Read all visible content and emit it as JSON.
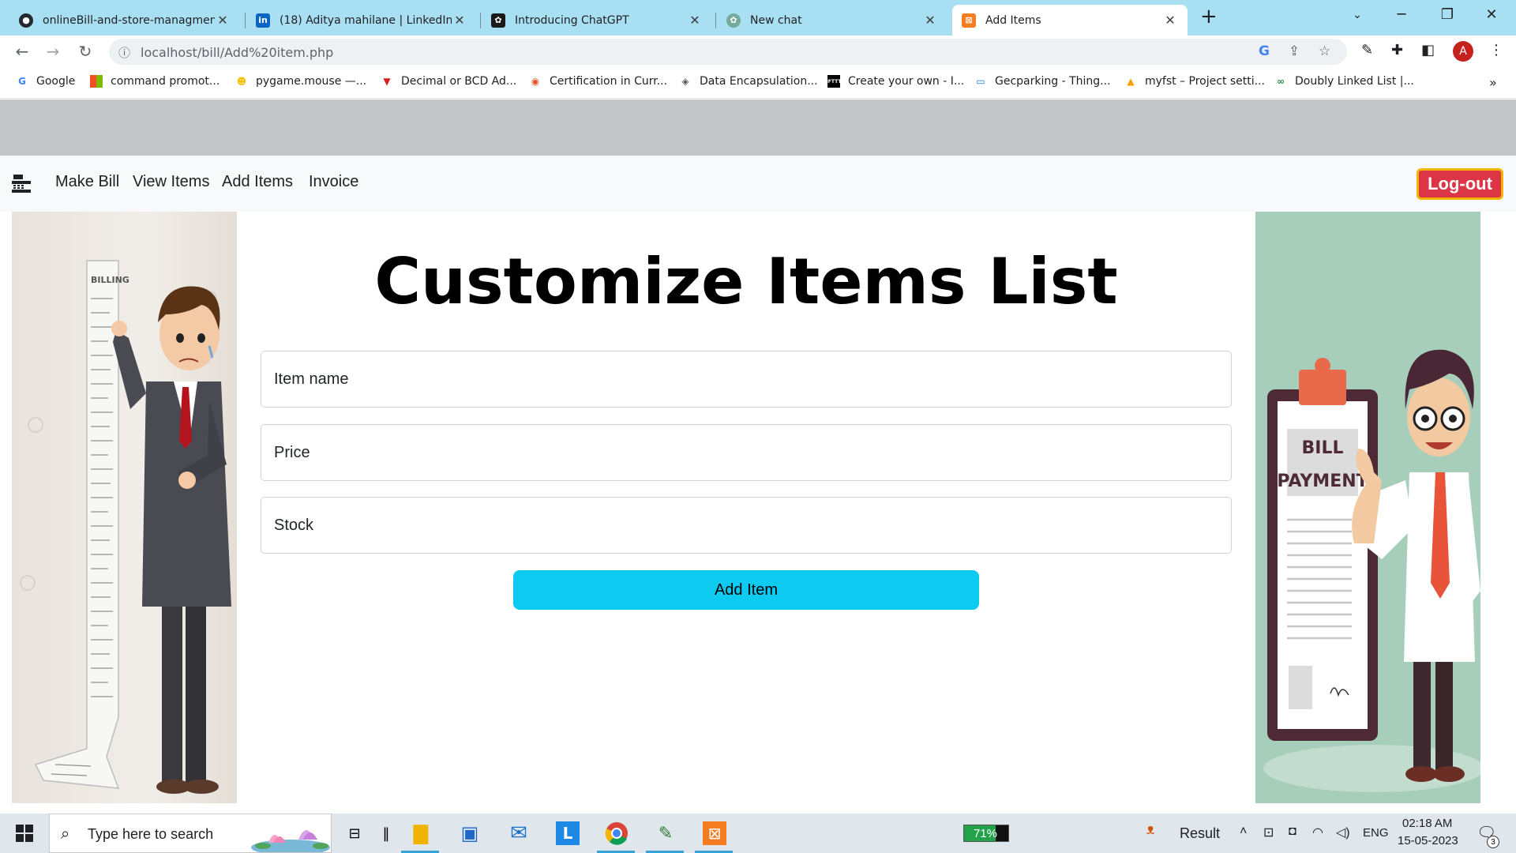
{
  "browser": {
    "tabs": [
      {
        "title": "onlineBill-and-store-managment",
        "icon": "github-icon"
      },
      {
        "title": "(18) Aditya mahilane | LinkedIn",
        "icon": "linkedin-icon"
      },
      {
        "title": "Introducing ChatGPT",
        "icon": "openai-icon"
      },
      {
        "title": "New chat",
        "icon": "openai-icon"
      },
      {
        "title": "Add Items",
        "icon": "xampp-icon",
        "active": true
      }
    ],
    "new_tab_glyph": "+",
    "url": "localhost/bill/Add%20item.php",
    "profile_initial": "A",
    "bookmarks": [
      {
        "label": "Google",
        "icon": "google-icon"
      },
      {
        "label": "command promot...",
        "icon": "microsoft-icon"
      },
      {
        "label": "pygame.mouse —...",
        "icon": "python-icon"
      },
      {
        "label": "Decimal or BCD Ad...",
        "icon": "v-icon"
      },
      {
        "label": "Certification in Curr...",
        "icon": "cert-icon"
      },
      {
        "label": "Data Encapsulation...",
        "icon": "diamond-icon"
      },
      {
        "label": "Create your own - I...",
        "icon": "ifttt-icon"
      },
      {
        "label": "Gecparking - Thing...",
        "icon": "chat-icon"
      },
      {
        "label": "myfst – Project setti...",
        "icon": "firebase-icon"
      },
      {
        "label": "Doubly Linked List |...",
        "icon": "gfg-icon"
      }
    ],
    "more_glyph": "»"
  },
  "navbar": {
    "links": [
      "Make Bill",
      "View Items",
      "Add Items",
      "Invoice"
    ],
    "logout_label": "Log-out"
  },
  "main": {
    "heading": "Customize Items List",
    "fields": [
      {
        "placeholder": "Item name"
      },
      {
        "placeholder": "Price"
      },
      {
        "placeholder": "Stock"
      }
    ],
    "submit_label": "Add Item"
  },
  "illustrations": {
    "left_receipt_text": "BILLING",
    "right_board_line1": "BILL",
    "right_board_line2": "PAYMENT"
  },
  "taskbar": {
    "search_placeholder": "Type here to search",
    "battery_percent": "71%",
    "result_label": "Result",
    "language": "ENG",
    "time": "02:18 AM",
    "date": "15-05-2023",
    "notification_count": "3"
  },
  "colors": {
    "tab_strip": "#a9dff2",
    "logout_bg": "#dc3545",
    "logout_border": "#f5b400",
    "submit_bg": "#0dcaf0",
    "band_gray": "#c3c5c8"
  }
}
